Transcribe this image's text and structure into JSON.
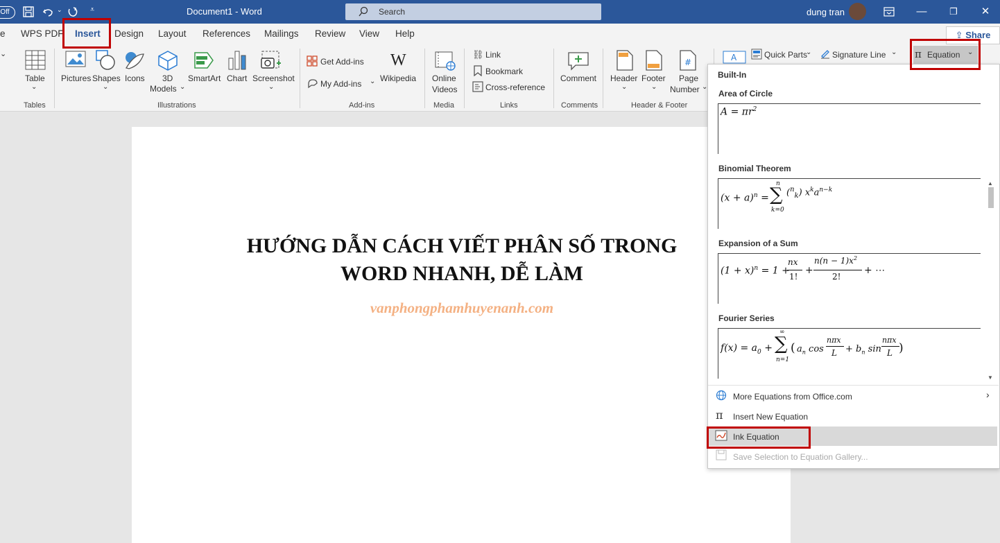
{
  "titlebar": {
    "autosave": "Off",
    "doc_title": "Document1  -  Word",
    "search_placeholder": "Search",
    "user": "dung tran"
  },
  "tabs": [
    "e",
    "WPS PDF",
    "Insert",
    "Design",
    "Layout",
    "References",
    "Mailings",
    "Review",
    "View",
    "Help"
  ],
  "share": "Share",
  "ribbon": {
    "table": "Table",
    "pictures": "Pictures",
    "shapes": "Shapes",
    "icons": "Icons",
    "models3d_1": "3D",
    "models3d_2": "Models",
    "smartart": "SmartArt",
    "chart": "Chart",
    "screenshot": "Screenshot",
    "get_addins": "Get Add-ins",
    "my_addins": "My Add-ins",
    "wikipedia": "Wikipedia",
    "online_videos_1": "Online",
    "online_videos_2": "Videos",
    "link": "Link",
    "bookmark": "Bookmark",
    "cross_reference": "Cross-reference",
    "comment": "Comment",
    "header": "Header",
    "footer": "Footer",
    "page_number_1": "Page",
    "page_number_2": "Number",
    "quick_parts": "Quick Parts",
    "signature_line": "Signature Line",
    "equation": "Equation",
    "groups": {
      "tables": "Tables",
      "illustrations": "Illustrations",
      "addins": "Add-ins",
      "media": "Media",
      "links": "Links",
      "comments": "Comments",
      "header_footer": "Header & Footer"
    }
  },
  "document": {
    "title_line1": "HƯỚNG DẪN CÁCH VIẾT PHÂN SỐ TRONG",
    "title_line2": "WORD NHANH, DỄ LÀM",
    "subtitle": "vanphongphamhuyenanh.com"
  },
  "dropdown": {
    "section": "Built-In",
    "equations": [
      {
        "name": "Area of Circle"
      },
      {
        "name": "Binomial Theorem"
      },
      {
        "name": "Expansion of a Sum"
      },
      {
        "name": "Fourier Series"
      }
    ],
    "menu": [
      {
        "label": "More Equations from Office.com"
      },
      {
        "label": "Insert New Equation"
      },
      {
        "label": "Ink Equation"
      },
      {
        "label": "Save Selection to Equation Gallery..."
      }
    ]
  },
  "colors": {
    "titlebar": "#2b579a",
    "highlight_box": "#c00000",
    "subtitle": "#f4b183"
  }
}
